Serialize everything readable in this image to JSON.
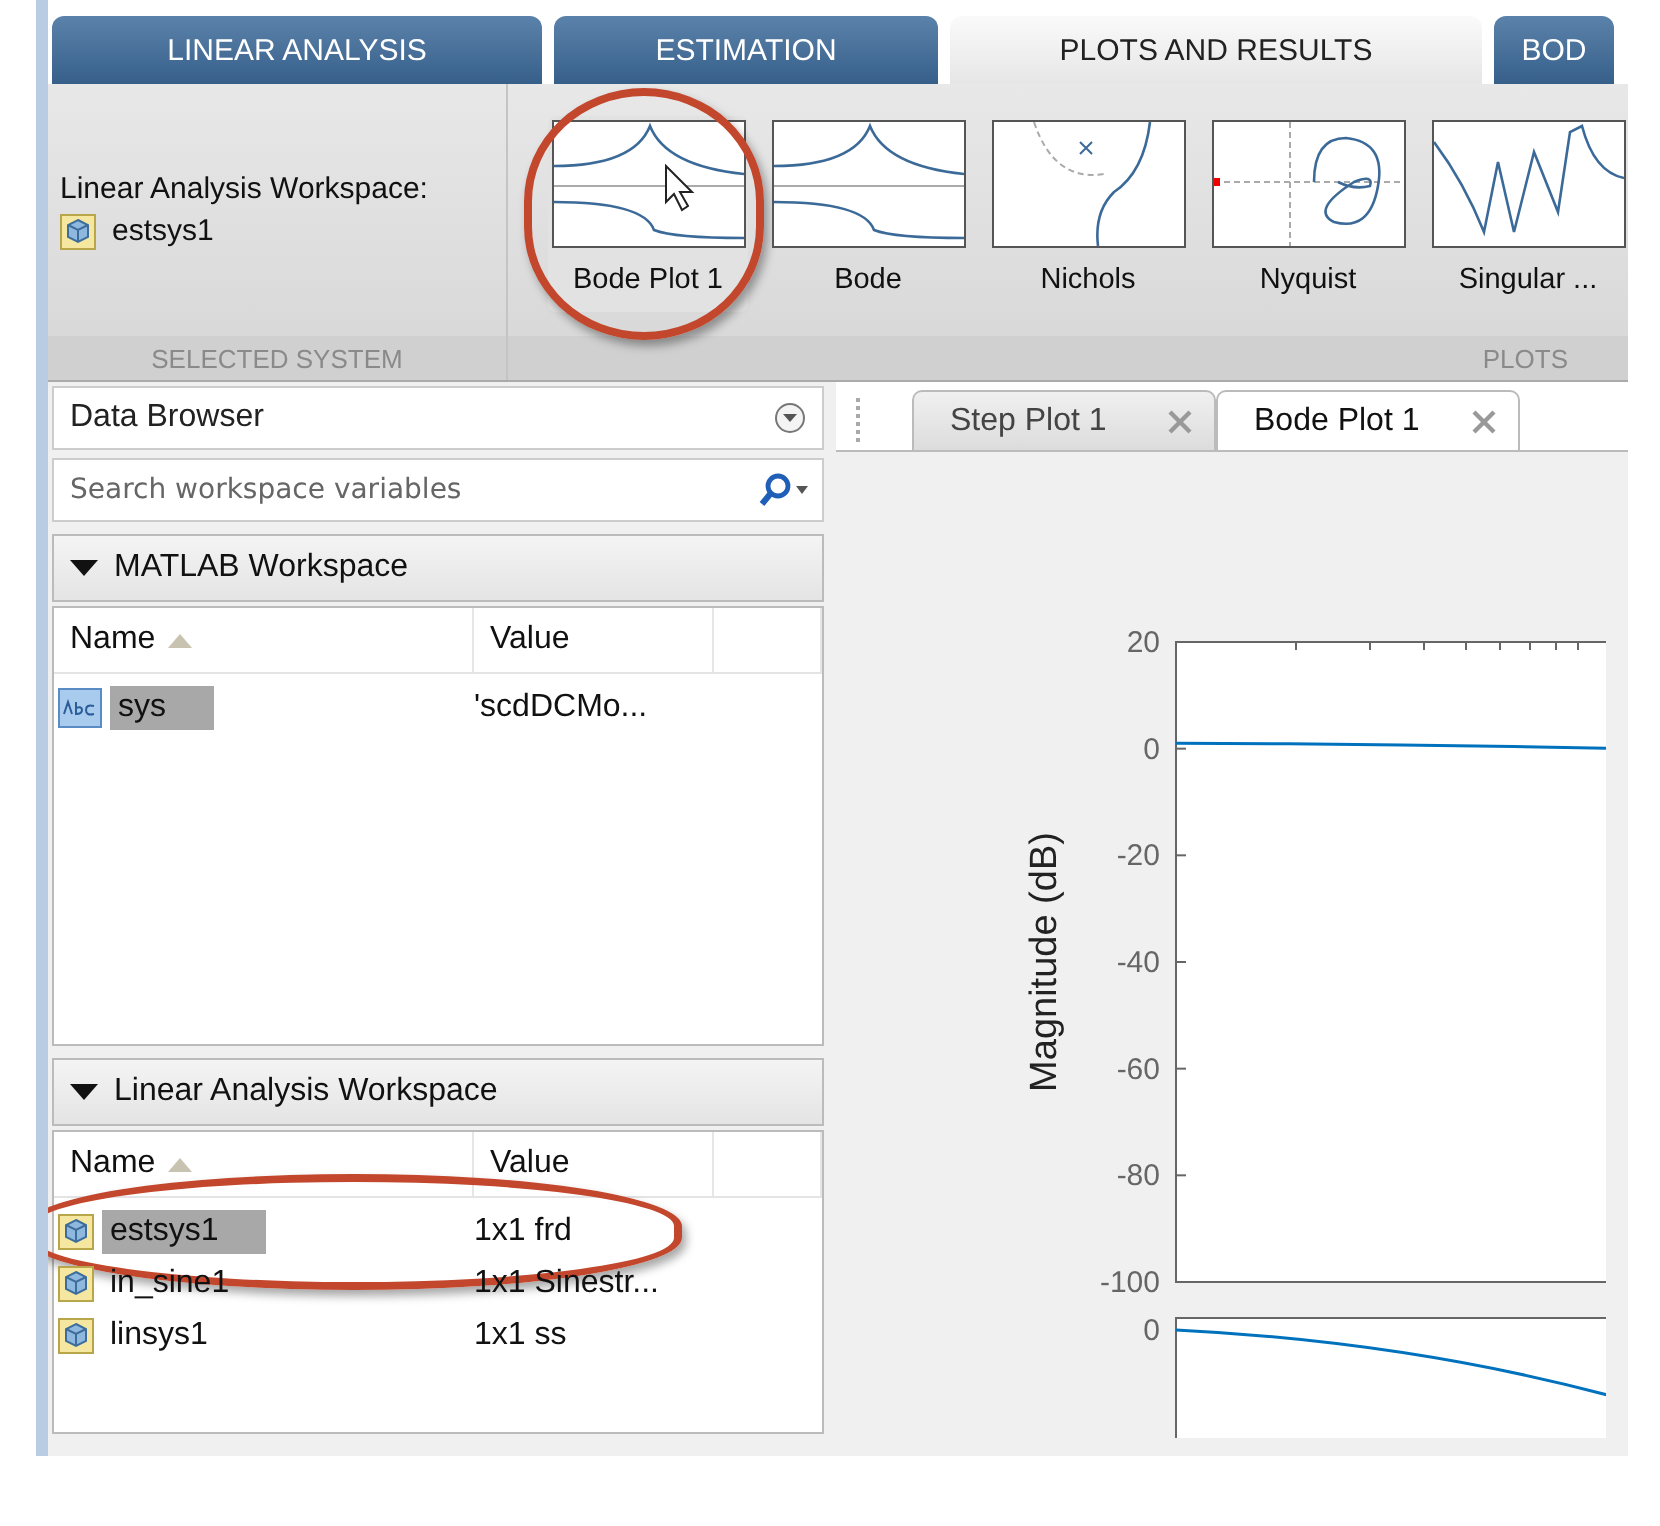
{
  "tabs": [
    {
      "label": "LINEAR ANALYSIS",
      "selected": false
    },
    {
      "label": "ESTIMATION",
      "selected": false
    },
    {
      "label": "PLOTS AND RESULTS",
      "selected": true
    },
    {
      "label": "BOD",
      "selected": false
    }
  ],
  "selected_system": {
    "label": "Linear Analysis Workspace:",
    "system": "estsys1",
    "footer": "SELECTED SYSTEM"
  },
  "plots_gallery": {
    "footer": "PLOTS",
    "items": [
      {
        "label": "Bode Plot 1",
        "kind": "bode",
        "highlighted": true,
        "hovered": true
      },
      {
        "label": "Bode",
        "kind": "bode",
        "highlighted": false,
        "hovered": false
      },
      {
        "label": "Nichols",
        "kind": "nichols",
        "highlighted": false,
        "hovered": false
      },
      {
        "label": "Nyquist",
        "kind": "nyquist",
        "highlighted": false,
        "hovered": false
      },
      {
        "label": "Singular ...",
        "kind": "singular",
        "highlighted": false,
        "hovered": false
      }
    ]
  },
  "data_browser": {
    "title": "Data Browser",
    "search": {
      "placeholder": "Search workspace variables"
    },
    "sections": [
      {
        "title": "MATLAB Workspace",
        "expanded": true,
        "columns": [
          "Name",
          "Value"
        ],
        "rows": [
          {
            "kind": "text",
            "name": "sys",
            "value": "'scdDCMo...",
            "selected": true,
            "highlighted": false
          }
        ]
      },
      {
        "title": "Linear Analysis Workspace",
        "expanded": true,
        "columns": [
          "Name",
          "Value"
        ],
        "rows": [
          {
            "kind": "model",
            "name": "estsys1",
            "value": "1x1 frd",
            "selected": true,
            "highlighted": true
          },
          {
            "kind": "model",
            "name": "in_sine1",
            "value": "1x1 Sinestr...",
            "selected": false,
            "highlighted": false
          },
          {
            "kind": "model",
            "name": "linsys1",
            "value": "1x1 ss",
            "selected": false,
            "highlighted": false
          }
        ]
      }
    ]
  },
  "plot_tabs": [
    {
      "label": "Step Plot 1",
      "selected": false
    },
    {
      "label": "Bode Plot 1",
      "selected": true
    }
  ],
  "magnitude_chart": {
    "chart_data": {
      "type": "line",
      "ylabel": "Magnitude (dB)",
      "ylim": [
        -100,
        20
      ],
      "yticks": [
        20,
        0,
        -20,
        -40,
        -60,
        -80,
        -100
      ],
      "series": [
        {
          "color": "#0072bd",
          "values": [
            1,
            0.9,
            0.7,
            0.4,
            0
          ]
        }
      ]
    }
  },
  "phase_chart": {
    "tick_label": "0"
  }
}
